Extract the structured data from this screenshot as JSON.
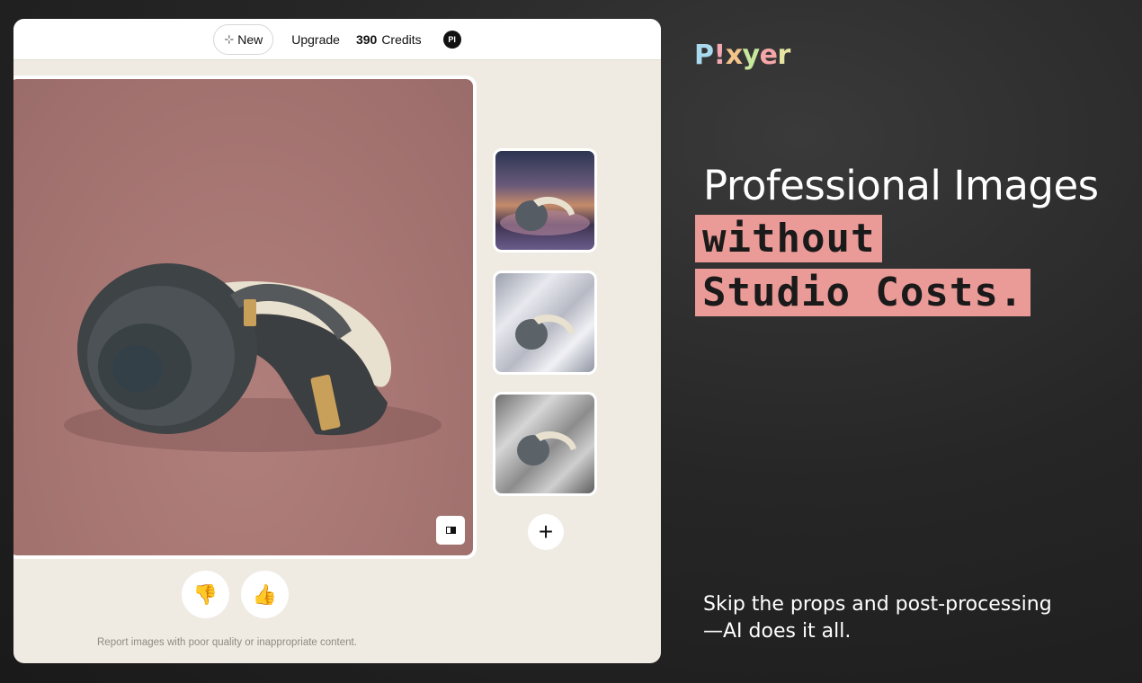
{
  "topbar": {
    "new_label": "New",
    "upgrade_label": "Upgrade",
    "credits_value": "390",
    "credits_label": "Credits",
    "avatar_initials": "PI"
  },
  "feedback": {
    "report_text": "Report images with poor quality or inappropriate content."
  },
  "brand": {
    "logo_letters": [
      "P",
      "!",
      "x",
      "y",
      "e",
      "r"
    ]
  },
  "marketing": {
    "headline": "Professional Images",
    "highlight_line1": "without",
    "highlight_line2": "Studio Costs.",
    "subtext_line1": "Skip the props and post-processing",
    "subtext_line2": "—AI does it all."
  },
  "colors": {
    "highlight_bg": "#ea9a97",
    "panel_bg": "#efebe3",
    "page_bg": "#262626"
  },
  "icons": [
    "crosshair-plus-icon",
    "compare-icon",
    "add-icon",
    "thumbs-down-icon",
    "thumbs-up-icon"
  ]
}
